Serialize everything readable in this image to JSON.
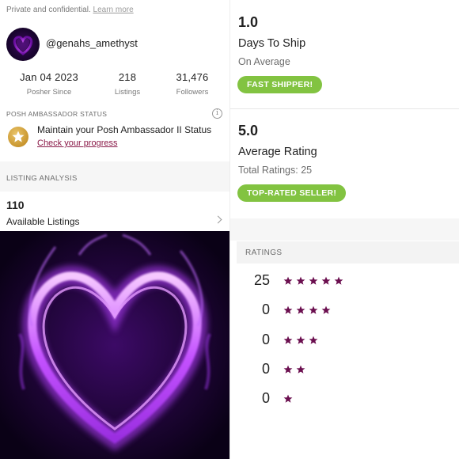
{
  "left": {
    "private_text": "Private and confidential.",
    "learn_more": "Learn more",
    "username": "@genahs_amethyst",
    "stats": [
      {
        "value": "Jan 04 2023",
        "label": "Posher Since"
      },
      {
        "value": "218",
        "label": "Listings"
      },
      {
        "value": "31,476",
        "label": "Followers"
      }
    ],
    "ambassador": {
      "section_title": "POSH AMBASSADOR STATUS",
      "info_icon": "info-icon",
      "text": "Maintain your Posh Ambassador II Status",
      "link": "Check your progress"
    },
    "listing_analysis": {
      "title": "LISTING ANALYSIS",
      "count": "110",
      "label": "Available Listings"
    }
  },
  "right": {
    "days_to_ship": {
      "value": "1.0",
      "title": "Days To Ship",
      "sub": "On Average",
      "badge": "FAST SHIPPER!"
    },
    "rating": {
      "value": "5.0",
      "title": "Average Rating",
      "sub": "Total Ratings: 25",
      "badge": "TOP-RATED SELLER!"
    },
    "ratings_title": "RATINGS",
    "ratings": [
      {
        "count": "25",
        "stars": 5
      },
      {
        "count": "0",
        "stars": 4
      },
      {
        "count": "0",
        "stars": 3
      },
      {
        "count": "0",
        "stars": 2
      },
      {
        "count": "0",
        "stars": 1
      }
    ]
  },
  "colors": {
    "accent_green": "#82c341",
    "star_color": "#6b0f4f",
    "link_color": "#8a1a48"
  }
}
